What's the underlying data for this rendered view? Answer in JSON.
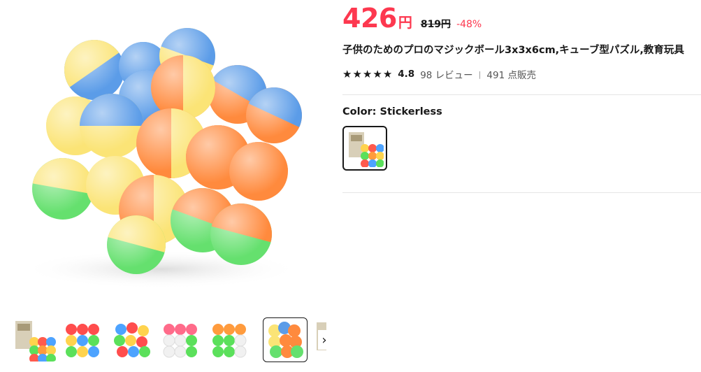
{
  "product": {
    "price": "426",
    "currency": "円",
    "original_price": "819円",
    "discount": "-48%",
    "title": "子供のためのプロのマジックボール3x3x6cm,キューブ型パズル,教育玩具",
    "rating": "4.8",
    "reviews": "98 レビュー",
    "separator": "|",
    "sold": "491 点販売",
    "stars": [
      "★",
      "★",
      "★",
      "★",
      "★"
    ]
  },
  "variant": {
    "label": "Color: Stickerless"
  },
  "gallery": {
    "next_arrow": "›",
    "thumbnails": [
      "box-and-cube",
      "rainbow-cube",
      "twisted-cube",
      "white-pink-cube",
      "orange-green-cube",
      "pastel-ball-cube"
    ],
    "active_index": 5
  },
  "colors": {
    "price": "#fd384f",
    "text": "#191919",
    "ball_orange": "#ff8a3d",
    "ball_yellow": "#fbe476",
    "ball_blue": "#5b9ce8",
    "ball_green": "#65e06e"
  }
}
